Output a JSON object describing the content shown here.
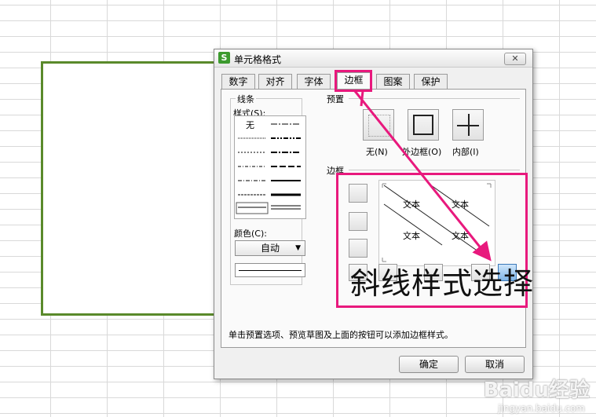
{
  "dialog": {
    "title": "单元格格式",
    "app_icon": "S",
    "close": "✕",
    "tabs": [
      "数字",
      "对齐",
      "字体",
      "边框",
      "图案",
      "保护"
    ],
    "active_tab": "边框"
  },
  "line": {
    "group_label": "线条",
    "style_label": "样式(S):",
    "none_label": "无",
    "color_label": "颜色(C):",
    "color_value": "自动"
  },
  "preset": {
    "label": "预置",
    "none": "无(N)",
    "outline": "外边框(O)",
    "inside": "内部(I)"
  },
  "border": {
    "label": "边框",
    "preview_text": "文本"
  },
  "hint": "单击预置选项、预览草图及上面的按钮可以添加边框样式。",
  "buttons": {
    "ok": "确定",
    "cancel": "取消"
  },
  "annotation": {
    "caption": "斜线样式选择",
    "color": "#e8197d"
  },
  "watermark": {
    "main": "Baidu经验",
    "sub": "jingyan.baidu.com"
  }
}
